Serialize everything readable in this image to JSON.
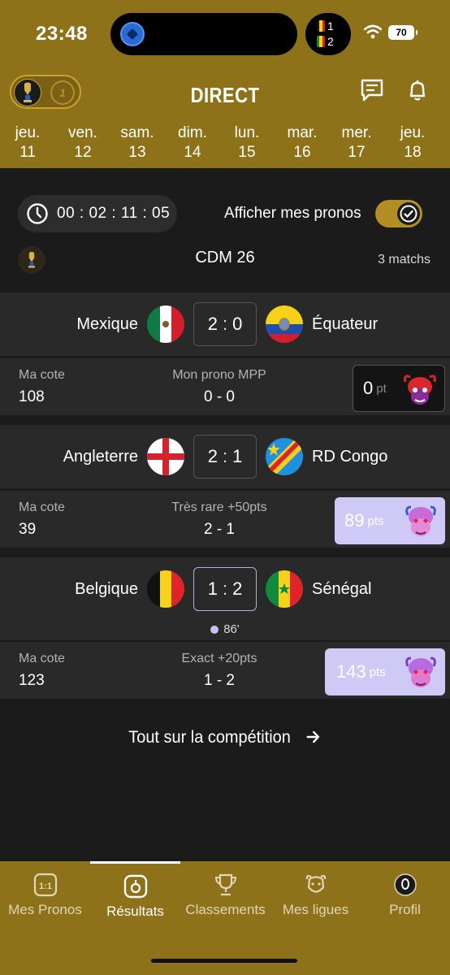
{
  "status_bar": {
    "time": "23:48",
    "battery": "70",
    "live_scores": [
      "1",
      "2"
    ]
  },
  "header": {
    "title": "DIRECT",
    "toggle_right_icon": "1v1-logo"
  },
  "days": [
    {
      "name": "jeu.",
      "num": "11"
    },
    {
      "name": "ven.",
      "num": "12"
    },
    {
      "name": "sam.",
      "num": "13"
    },
    {
      "name": "dim.",
      "num": "14"
    },
    {
      "name": "lun.",
      "num": "15"
    },
    {
      "name": "mar.",
      "num": "16"
    },
    {
      "name": "mer.",
      "num": "17"
    },
    {
      "name": "jeu.",
      "num": "18"
    }
  ],
  "timer": "00 : 02 : 11 : 05",
  "show_predictions_label": "Afficher mes pronos",
  "show_predictions_on": true,
  "competition": {
    "name": "CDM 26",
    "count": "3 matchs"
  },
  "matches": [
    {
      "home": "Mexique",
      "away": "Équateur",
      "home_score": "2",
      "away_score": "0",
      "cote_label": "Ma cote",
      "cote": "108",
      "prono_label": "Mon prono MPP",
      "prono": "0 - 0",
      "points": "0",
      "points_unit": "pt"
    },
    {
      "home": "Angleterre",
      "away": "RD Congo",
      "home_score": "2",
      "away_score": "1",
      "cote_label": "Ma cote",
      "cote": "39",
      "prono_label": "Très rare +50pts",
      "prono": "2 - 1",
      "points": "89",
      "points_unit": "pts"
    },
    {
      "home": "Belgique",
      "away": "Sénégal",
      "home_score": "1",
      "away_score": "2",
      "minute": "86'",
      "cote_label": "Ma cote",
      "cote": "123",
      "prono_label": "Exact +20pts",
      "prono": "1 - 2",
      "points": "143",
      "points_unit": "pts"
    }
  ],
  "all_competition_link": "Tout sur la compétition",
  "nav": [
    {
      "label": "Mes Pronos",
      "icon": "1v1-icon"
    },
    {
      "label": "Résultats",
      "icon": "whistle-icon",
      "active": true
    },
    {
      "label": "Classements",
      "icon": "trophy-icon"
    },
    {
      "label": "Mes ligues",
      "icon": "bison-icon"
    },
    {
      "label": "Profil",
      "icon": "avatar-icon"
    }
  ],
  "colors": {
    "gold": "#8e721a",
    "background": "#1b1b1b",
    "card": "#292929",
    "lavender": "#cfc9f5"
  }
}
